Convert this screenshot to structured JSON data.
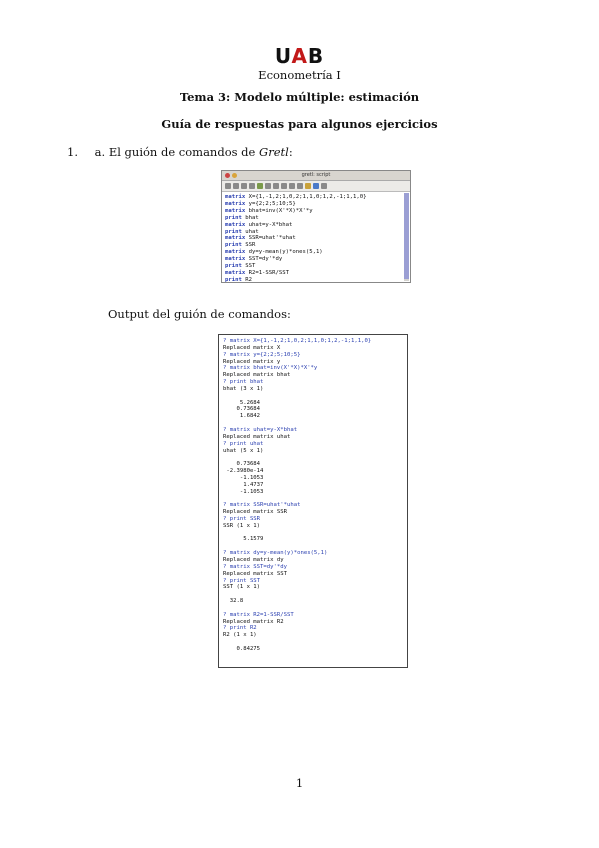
{
  "header": {
    "logo_left": "U",
    "logo_mid": "A",
    "logo_right": "B",
    "subject": "Econometría I",
    "title": "Tema 3: Modelo múltiple: estimación",
    "subtitle": "Guía de respuestas para algunos ejercicios"
  },
  "item": {
    "number": "1.",
    "prefix": "a. El guión de comandos de ",
    "app": "Gretl",
    "suffix": ":"
  },
  "script_window": {
    "title": "gretl: script",
    "lines": [
      "matrix X={1,-1,2;1,0,2;1,1,0;1,2,-1;1,1,0}",
      "matrix y={2;2;5;10;5}",
      "matrix bhat=inv(X'*X)*X'*y",
      "print bhat",
      "matrix uhat=y-X*bhat",
      "print uhat",
      "matrix SSR=uhat'*uhat",
      "print SSR",
      "matrix dy=y-mean(y)*ones(5,1)",
      "matrix SST=dy'*dy",
      "print SST",
      "matrix R2=1-SSR/SST",
      "print R2"
    ]
  },
  "output_label": "Output del guión de comandos:",
  "output": [
    {
      "t": "? matrix X={1,-1,2;1,0,2;1,1,0;1,2,-1;1,1,0}",
      "cmd": true
    },
    {
      "t": "Replaced matrix X",
      "cmd": false
    },
    {
      "t": "? matrix y={2;2;5;10;5}",
      "cmd": true
    },
    {
      "t": "Replaced matrix y",
      "cmd": false
    },
    {
      "t": "? matrix bhat=inv(X'*X)*X'*y",
      "cmd": true
    },
    {
      "t": "Replaced matrix bhat",
      "cmd": false
    },
    {
      "t": "? print bhat",
      "cmd": true
    },
    {
      "t": "bhat (3 x 1)",
      "cmd": false
    },
    {
      "t": "",
      "cmd": false
    },
    {
      "t": "     5.2684",
      "cmd": false
    },
    {
      "t": "    0.73684",
      "cmd": false
    },
    {
      "t": "     1.6842",
      "cmd": false
    },
    {
      "t": "",
      "cmd": false
    },
    {
      "t": "? matrix uhat=y-X*bhat",
      "cmd": true
    },
    {
      "t": "Replaced matrix uhat",
      "cmd": false
    },
    {
      "t": "? print uhat",
      "cmd": true
    },
    {
      "t": "uhat (5 x 1)",
      "cmd": false
    },
    {
      "t": "",
      "cmd": false
    },
    {
      "t": "    0.73684",
      "cmd": false
    },
    {
      "t": " -2.3980e-14",
      "cmd": false
    },
    {
      "t": "     -1.1053",
      "cmd": false
    },
    {
      "t": "      1.4737",
      "cmd": false
    },
    {
      "t": "     -1.1053",
      "cmd": false
    },
    {
      "t": "",
      "cmd": false
    },
    {
      "t": "? matrix SSR=uhat'*uhat",
      "cmd": true
    },
    {
      "t": "Replaced matrix SSR",
      "cmd": false
    },
    {
      "t": "? print SSR",
      "cmd": true
    },
    {
      "t": "SSR (1 x 1)",
      "cmd": false
    },
    {
      "t": "",
      "cmd": false
    },
    {
      "t": "      5.1579",
      "cmd": false
    },
    {
      "t": "",
      "cmd": false
    },
    {
      "t": "? matrix dy=y-mean(y)*ones(5,1)",
      "cmd": true
    },
    {
      "t": "Replaced matrix dy",
      "cmd": false
    },
    {
      "t": "? matrix SST=dy'*dy",
      "cmd": true
    },
    {
      "t": "Replaced matrix SST",
      "cmd": false
    },
    {
      "t": "? print SST",
      "cmd": true
    },
    {
      "t": "SST (1 x 1)",
      "cmd": false
    },
    {
      "t": "",
      "cmd": false
    },
    {
      "t": "  32.8",
      "cmd": false
    },
    {
      "t": "",
      "cmd": false
    },
    {
      "t": "? matrix R2=1-SSR/SST",
      "cmd": true
    },
    {
      "t": "Replaced matrix R2",
      "cmd": false
    },
    {
      "t": "? print R2",
      "cmd": true
    },
    {
      "t": "R2 (1 x 1)",
      "cmd": false
    },
    {
      "t": "",
      "cmd": false
    },
    {
      "t": "    0.84275",
      "cmd": false
    }
  ],
  "page_number": "1"
}
